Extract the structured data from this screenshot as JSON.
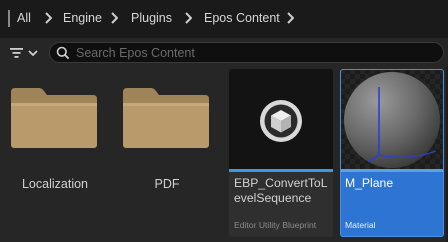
{
  "breadcrumb": {
    "items": [
      "All",
      "Engine",
      "Plugins",
      "Epos Content"
    ]
  },
  "search": {
    "placeholder": "Search Epos Content",
    "value": ""
  },
  "folders": [
    {
      "label": "Localization",
      "icon": "folder-icon"
    },
    {
      "label": "PDF",
      "icon": "folder-icon"
    }
  ],
  "assets": [
    {
      "name": "EBP_ConvertToLevelSequence",
      "type": "Editor Utility Blueprint",
      "stripe_color": "#3b9ae1",
      "icon": "blueprint-cube-icon",
      "selected": false
    },
    {
      "name": "M_Plane",
      "type": "Material",
      "stripe_color": "#5aa2e6",
      "icon": "material-sphere-icon",
      "selected": true
    }
  ],
  "colors": {
    "selection": "#2d74d3",
    "folder": "#b89a6b",
    "background": "#262626"
  }
}
